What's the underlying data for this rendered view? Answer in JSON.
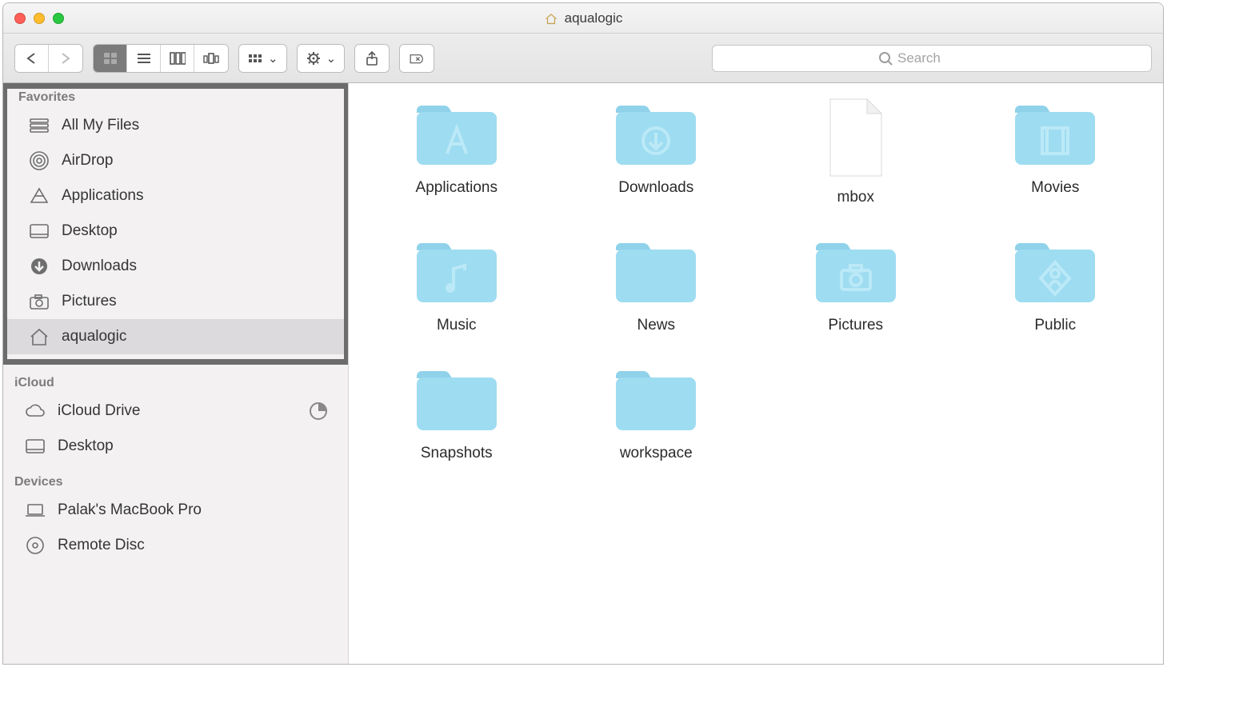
{
  "window": {
    "title": "aqualogic"
  },
  "search": {
    "placeholder": "Search"
  },
  "sidebar": {
    "sections": {
      "favorites": {
        "title": "Favorites",
        "items": [
          {
            "label": "All My Files",
            "icon": "stack-icon"
          },
          {
            "label": "AirDrop",
            "icon": "airdrop-icon"
          },
          {
            "label": "Applications",
            "icon": "applications-icon"
          },
          {
            "label": "Desktop",
            "icon": "desktop-icon"
          },
          {
            "label": "Downloads",
            "icon": "downloads-icon"
          },
          {
            "label": "Pictures",
            "icon": "camera-icon"
          },
          {
            "label": "aqualogic",
            "icon": "home-icon",
            "selected": true
          }
        ]
      },
      "icloud": {
        "title": "iCloud",
        "items": [
          {
            "label": "iCloud Drive",
            "icon": "cloud-icon"
          },
          {
            "label": "Desktop",
            "icon": "desktop-icon"
          }
        ]
      },
      "devices": {
        "title": "Devices",
        "items": [
          {
            "label": "Palak's MacBook Pro",
            "icon": "laptop-icon"
          },
          {
            "label": "Remote Disc",
            "icon": "disc-icon"
          }
        ]
      }
    }
  },
  "content": {
    "items": [
      {
        "label": "Applications",
        "type": "folder",
        "emblem": "A"
      },
      {
        "label": "Downloads",
        "type": "folder",
        "emblem": "down"
      },
      {
        "label": "mbox",
        "type": "file"
      },
      {
        "label": "Movies",
        "type": "folder",
        "emblem": "movie"
      },
      {
        "label": "Music",
        "type": "folder",
        "emblem": "music"
      },
      {
        "label": "News",
        "type": "folder",
        "emblem": "none"
      },
      {
        "label": "Pictures",
        "type": "folder",
        "emblem": "camera"
      },
      {
        "label": "Public",
        "type": "folder",
        "emblem": "public"
      },
      {
        "label": "Snapshots",
        "type": "folder",
        "emblem": "none"
      },
      {
        "label": "workspace",
        "type": "folder",
        "emblem": "none"
      }
    ]
  }
}
